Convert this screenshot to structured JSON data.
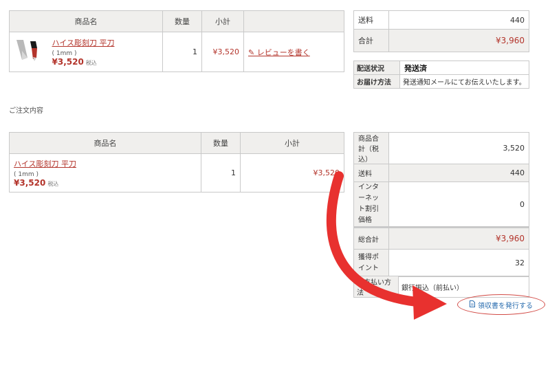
{
  "top": {
    "headers": {
      "product": "商品名",
      "qty": "数量",
      "subtotal": "小計",
      "action": ""
    },
    "row": {
      "name": "ハイス彫刻刀 平刀",
      "option": "( 1mm )",
      "price": "¥3,520",
      "tax": "税込",
      "qty": "1",
      "subtotal": "¥3,520",
      "review": "✎ レビューを書く"
    },
    "summary": {
      "shipping_label": "送料",
      "shipping_value": "440",
      "total_label": "合計",
      "total_value": "¥3,960"
    },
    "delivery": {
      "status_label": "配送状況",
      "status_value": "発送済",
      "method_label": "お届け方法",
      "method_value": "発送通知メールにてお伝えいたします。"
    }
  },
  "section_title": "ご注文内容",
  "order": {
    "headers": {
      "product": "商品名",
      "qty": "数量",
      "subtotal": "小計"
    },
    "row": {
      "name": "ハイス彫刻刀 平刀",
      "option": "( 1mm )",
      "price": "¥3,520",
      "tax": "税込",
      "qty": "1",
      "subtotal": "¥3,520"
    },
    "summary": [
      {
        "label": "商品合計（税込）",
        "value": "3,520",
        "shaded": false
      },
      {
        "label": "送料",
        "value": "440",
        "shaded": true
      },
      {
        "label": "インターネット割引価格",
        "value": "0",
        "shaded": false
      },
      {
        "label": "総合計",
        "value": "¥3,960",
        "shaded": true,
        "red": true
      },
      {
        "label": "獲得ポイント",
        "value": "32",
        "shaded": false
      }
    ],
    "payment": {
      "label": "お支払い方法",
      "value": "銀行振込（前払い）"
    }
  },
  "receipt_button": "領収書を発行する",
  "icons": {
    "receipt": "document-icon",
    "pencil": "pencil-icon"
  },
  "colors": {
    "accent": "#b3342b",
    "arrow": "#e8312f",
    "link": "#2d6fb0"
  }
}
